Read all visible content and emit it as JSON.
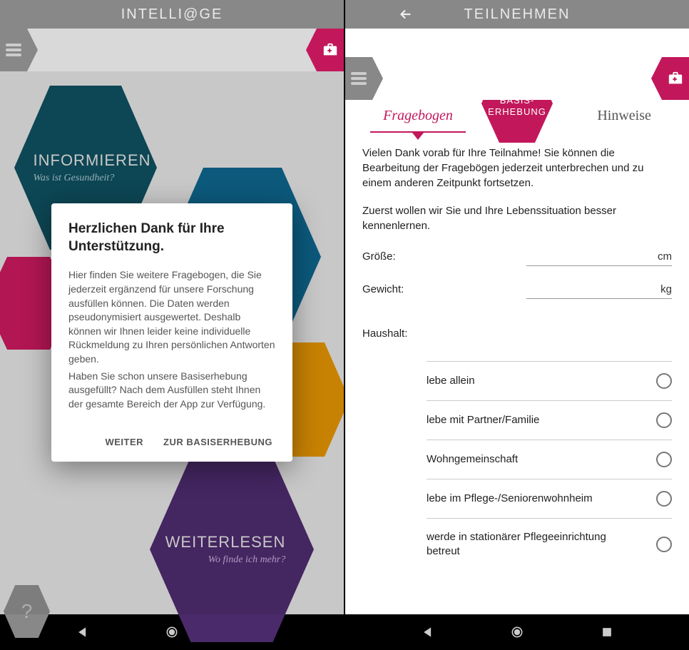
{
  "left": {
    "header_title": "INTELLI@GE",
    "hexes": {
      "inform_title": "INFORMIEREN",
      "inform_sub": "Was ist Gesundheit?",
      "weiter_title": "WEITERLESEN",
      "weiter_sub": "Wo finde ich mehr?",
      "help": "?"
    },
    "dialog": {
      "title": "Herzlichen Dank für Ihre Unterstützung.",
      "p1": "Hier finden Sie weitere Fragebogen, die Sie jederzeit ergänzend für unsere Forschung ausfüllen können. Die Daten werden pseudonymisiert ausgewertet. Deshalb können wir Ihnen leider keine individuelle Rückmeldung zu Ihren persönlichen Antworten geben.",
      "p2": "Haben Sie schon unsere Basiserhebung ausgefüllt? Nach dem Ausfüllen steht Ihnen der gesamte Bereich der App zur Verfügung.",
      "btn_continue": "WEITER",
      "btn_basis": "ZUR BASISERHEBUNG"
    }
  },
  "right": {
    "header_title": "TEILNEHMEN",
    "badge_line1": "BASIS-",
    "badge_line2": "ERHEBUNG",
    "tab_fragebogen": "Fragebogen",
    "tab_hinweise": "Hinweise",
    "intro1": "Vielen Dank vorab für Ihre Teilnahme! Sie können die Bearbeitung der Fragebögen jederzeit unterbrechen und zu einem anderen Zeitpunkt fortsetzen.",
    "intro2": "Zuerst wollen wir Sie und Ihre Lebenssituation besser kennenlernen.",
    "fields": {
      "groesse_label": "Größe:",
      "groesse_unit": "cm",
      "gewicht_label": "Gewicht:",
      "gewicht_unit": "kg",
      "haushalt_label": "Haushalt:"
    },
    "options": [
      "lebe allein",
      "lebe mit Partner/Familie",
      "Wohngemeinschaft",
      "lebe im Pflege-/Seniorenwohnheim",
      "werde in stationärer Pflegeeinrichtung betreut"
    ]
  }
}
